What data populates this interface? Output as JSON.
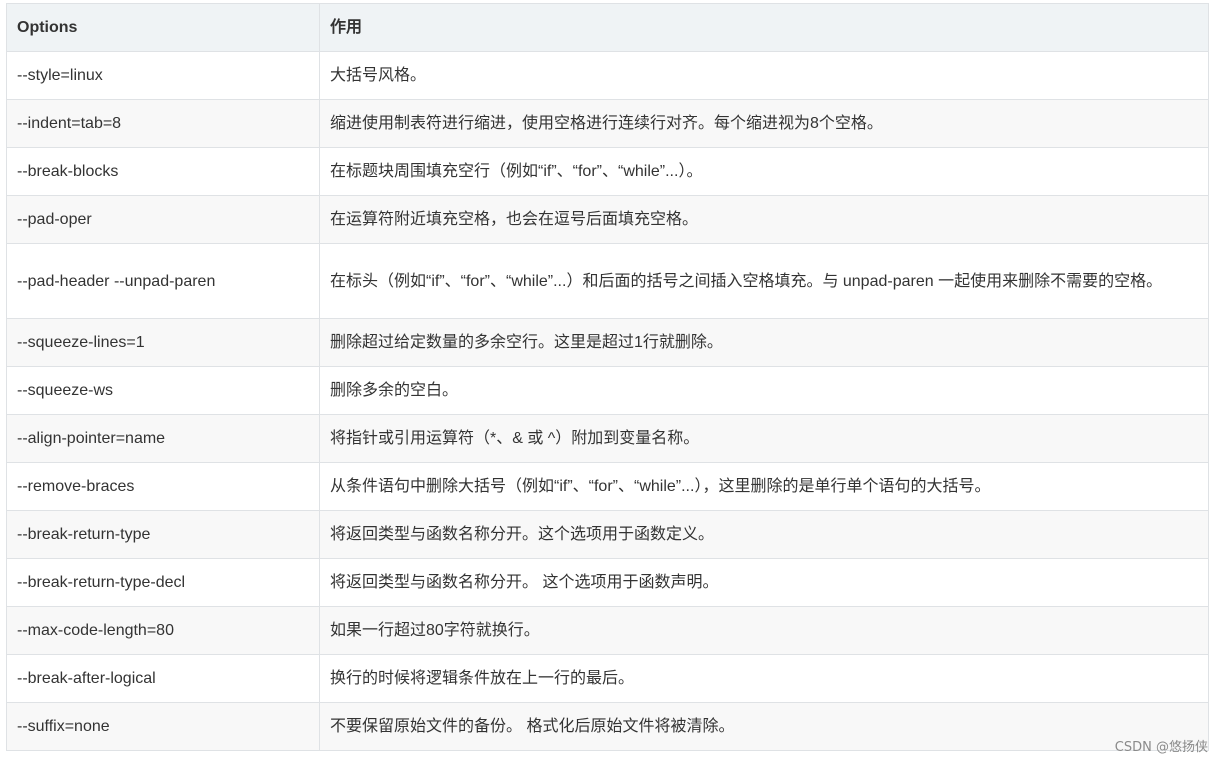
{
  "table": {
    "headers": [
      "Options",
      "作用"
    ],
    "rows": [
      {
        "option": "--style=linux",
        "desc": "大括号风格。"
      },
      {
        "option": "--indent=tab=8",
        "desc": "缩进使用制表符进行缩进，使用空格进行连续行对齐。每个缩进视为8个空格。"
      },
      {
        "option": "--break-blocks",
        "desc": "在标题块周围填充空行（例如“if”、“for”、“while”...）。"
      },
      {
        "option": "--pad-oper",
        "desc": "在运算符附近填充空格，也会在逗号后面填充空格。"
      },
      {
        "option": "--pad-header --unpad-paren",
        "desc": "在标头（例如“if”、“for”、“while”...）和后面的括号之间插入空格填充。与 unpad-paren 一起使用来删除不需要的空格。"
      },
      {
        "option": "--squeeze-lines=1",
        "desc": "删除超过给定数量的多余空行。这里是超过1行就删除。"
      },
      {
        "option": "--squeeze-ws",
        "desc": "删除多余的空白。"
      },
      {
        "option": "--align-pointer=name",
        "desc": "将指针或引用运算符（*、& 或 ^）附加到变量名称。"
      },
      {
        "option": "--remove-braces",
        "desc": "从条件语句中删除大括号（例如“if”、“for”、“while”...），这里删除的是单行单个语句的大括号。"
      },
      {
        "option": "--break-return-type",
        "desc": "将返回类型与函数名称分开。这个选项用于函数定义。"
      },
      {
        "option": "--break-return-type-decl",
        "desc": "将返回类型与函数名称分开。 这个选项用于函数声明。"
      },
      {
        "option": "--max-code-length=80",
        "desc": "如果一行超过80字符就换行。"
      },
      {
        "option": "--break-after-logical",
        "desc": "换行的时候将逻辑条件放在上一行的最后。"
      },
      {
        "option": "--suffix=none",
        "desc": "不要保留原始文件的备份。 格式化后原始文件将被清除。"
      }
    ]
  },
  "watermark": "CSDN @悠扬侠"
}
